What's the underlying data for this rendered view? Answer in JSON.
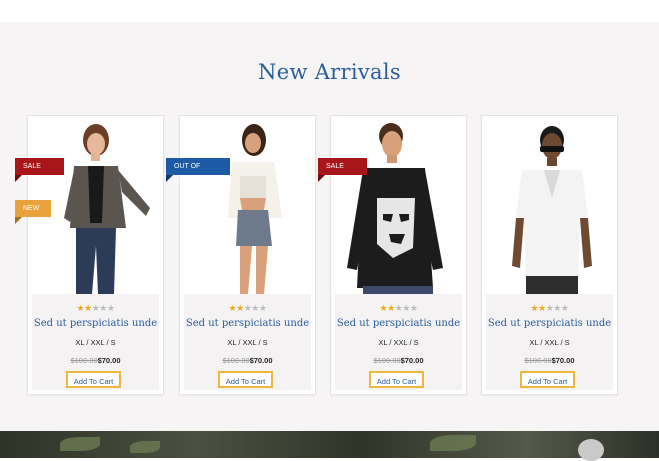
{
  "section": {
    "title": "New Arrivals"
  },
  "products": [
    {
      "name": "Sed ut perspiciatis unde",
      "sizes": "XL / XXL / S",
      "old_price": "$100.00",
      "price": "$70.00",
      "cart_label": "Add To Cart",
      "rating": 2.5,
      "badges": [
        {
          "label": "SALE",
          "color": "#a8161c"
        },
        {
          "label": "NEW",
          "color": "#e9a23b"
        }
      ]
    },
    {
      "name": "Sed ut perspiciatis unde",
      "sizes": "XL / XXL / S",
      "old_price": "$100.00",
      "price": "$70.00",
      "cart_label": "Add To Cart",
      "rating": 2.5,
      "badges": [
        {
          "label": "OUT OF STOCK",
          "color": "#1c5aa6"
        }
      ]
    },
    {
      "name": "Sed ut perspiciatis unde",
      "sizes": "XL / XXL / S",
      "old_price": "$100.00",
      "price": "$70.00",
      "cart_label": "Add To Cart",
      "rating": 2.5,
      "badges": [
        {
          "label": "SALE",
          "color": "#a8161c"
        }
      ]
    },
    {
      "name": "Sed ut perspiciatis unde",
      "sizes": "XL / XXL / S",
      "old_price": "$100.00",
      "price": "$70.00",
      "cart_label": "Add To Cart",
      "rating": 2.5,
      "badges": []
    }
  ],
  "colors": {
    "title": "#2a5d9c",
    "star_on": "#f0a91e",
    "cart_border": "#efb640"
  }
}
